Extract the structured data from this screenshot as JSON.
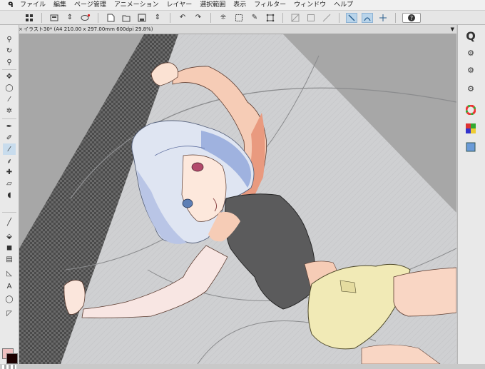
{
  "menu": {
    "items": [
      "ファイル",
      "編集",
      "ページ管理",
      "アニメーション",
      "レイヤー",
      "選択範囲",
      "表示",
      "フィルター",
      "ウィンドウ",
      "ヘルプ"
    ]
  },
  "document": {
    "tab_title": "イラスト30* (A4 210.00 x 297.00mm 600dpi 29.8%)",
    "close_glyph": "×",
    "menu_glyph": "▼"
  },
  "colors": {
    "main_color": "#f0c0c0",
    "sub_color": "#1b0000",
    "accent": "#b9d4ea"
  },
  "icons": {
    "app_logo": "clip-studio-logo",
    "toolbar": [
      "grid-icon",
      "save-icon",
      "undo-redo-arrows-icon",
      "swirl-icon",
      "new-page-icon",
      "open-icon",
      "save-file-icon",
      "layer-arrows-icon",
      "undo-icon",
      "redo-icon",
      "transform-icon",
      "select-all-icon",
      "pen-select-icon",
      "selection-icon",
      "slash-icon",
      "frame-icon",
      "ruler-icon",
      "snap-icon",
      "special-ruler-icon",
      "help-icon"
    ],
    "right_panel": [
      "quick-access-icon",
      "tool-property-icon",
      "sub-tool-icon",
      "brush-size-icon",
      "color-wheel-icon",
      "color-set-icon",
      "layer-icon"
    ]
  },
  "status": {
    "zoom": "29.8%"
  }
}
